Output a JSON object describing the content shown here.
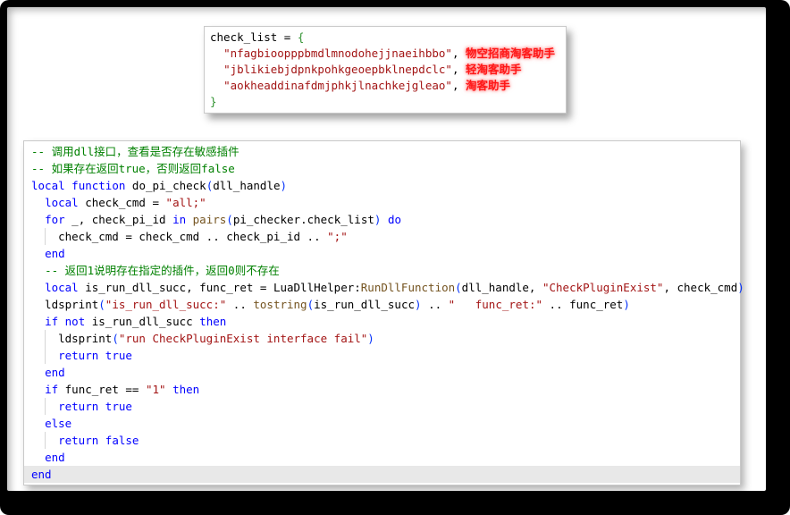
{
  "colors": {
    "plain": "#010101",
    "kw": "#0000ff",
    "str": "#a31515",
    "com": "#008000",
    "fn": "#74531f",
    "brace": "#319331",
    "paren": "#0431fa",
    "ann": "#ff1616",
    "hl": "#e8e8e8"
  },
  "top_panel": {
    "lines": [
      {
        "tokens": [
          {
            "t": "check_list = ",
            "c": "plain"
          },
          {
            "t": "{",
            "c": "brace"
          }
        ]
      },
      {
        "tokens": [
          {
            "t": "  ",
            "c": "plain"
          },
          {
            "t": "\"nfagbioopppbmdlmnodohejjnaeihbbo\"",
            "c": "str"
          },
          {
            "t": ", ",
            "c": "plain"
          },
          {
            "t": "物空招商淘客助手",
            "c": "ann"
          }
        ]
      },
      {
        "tokens": [
          {
            "t": "  ",
            "c": "plain"
          },
          {
            "t": "\"jblikiebjdpnkpohkgeoepbklnepdclc\"",
            "c": "str"
          },
          {
            "t": ", ",
            "c": "plain"
          },
          {
            "t": "轻淘客助手",
            "c": "ann"
          }
        ]
      },
      {
        "tokens": [
          {
            "t": "  ",
            "c": "plain"
          },
          {
            "t": "\"aokheaddinafdmjphkjlnachkejgleao\"",
            "c": "str"
          },
          {
            "t": ", ",
            "c": "plain"
          },
          {
            "t": "淘客助手",
            "c": "ann"
          }
        ]
      },
      {
        "tokens": [
          {
            "t": "}",
            "c": "brace"
          }
        ]
      }
    ]
  },
  "code_panel": {
    "lines": [
      {
        "tokens": [
          {
            "t": "-- 调用dll接口，查看是否存在敏感插件",
            "c": "com"
          }
        ]
      },
      {
        "tokens": [
          {
            "t": "-- 如果存在返回true，否则返回false",
            "c": "com"
          }
        ]
      },
      {
        "tokens": [
          {
            "t": "local",
            "c": "kw"
          },
          {
            "t": " ",
            "c": "plain"
          },
          {
            "t": "function",
            "c": "kw"
          },
          {
            "t": " do_pi_check",
            "c": "plain"
          },
          {
            "t": "(",
            "c": "paren"
          },
          {
            "t": "dll_handle",
            "c": "plain"
          },
          {
            "t": ")",
            "c": "paren"
          }
        ]
      },
      {
        "tokens": [
          {
            "t": "  ",
            "c": "plain"
          },
          {
            "t": "local",
            "c": "kw"
          },
          {
            "t": " check_cmd = ",
            "c": "plain"
          },
          {
            "t": "\"all;\"",
            "c": "str"
          }
        ]
      },
      {
        "tokens": [
          {
            "t": "  ",
            "c": "plain"
          },
          {
            "t": "for",
            "c": "kw"
          },
          {
            "t": " _, check_pi_id ",
            "c": "plain"
          },
          {
            "t": "in",
            "c": "kw"
          },
          {
            "t": " ",
            "c": "plain"
          },
          {
            "t": "pairs",
            "c": "fn"
          },
          {
            "t": "(",
            "c": "paren"
          },
          {
            "t": "pi_checker.check_list",
            "c": "plain"
          },
          {
            "t": ")",
            "c": "paren"
          },
          {
            "t": " ",
            "c": "plain"
          },
          {
            "t": "do",
            "c": "kw"
          }
        ]
      },
      {
        "g": 1,
        "tokens": [
          {
            "t": "    check_cmd = check_cmd .. check_pi_id .. ",
            "c": "plain"
          },
          {
            "t": "\";\"",
            "c": "str"
          }
        ]
      },
      {
        "tokens": [
          {
            "t": "  ",
            "c": "plain"
          },
          {
            "t": "end",
            "c": "kw"
          }
        ]
      },
      {
        "tokens": [
          {
            "t": "  ",
            "c": "plain"
          },
          {
            "t": "-- 返回1说明存在指定的插件，返回0则不存在",
            "c": "com"
          }
        ]
      },
      {
        "tokens": [
          {
            "t": "  ",
            "c": "plain"
          },
          {
            "t": "local",
            "c": "kw"
          },
          {
            "t": " is_run_dll_succ, func_ret = LuaDllHelper:",
            "c": "plain"
          },
          {
            "t": "RunDllFunction",
            "c": "fn"
          },
          {
            "t": "(",
            "c": "paren"
          },
          {
            "t": "dll_handle, ",
            "c": "plain"
          },
          {
            "t": "\"CheckPluginExist\"",
            "c": "str"
          },
          {
            "t": ", check_cmd",
            "c": "plain"
          },
          {
            "t": ")",
            "c": "paren"
          }
        ]
      },
      {
        "tokens": [
          {
            "t": "  ldsprint",
            "c": "plain"
          },
          {
            "t": "(",
            "c": "paren"
          },
          {
            "t": "\"is_run_dll_succ:\"",
            "c": "str"
          },
          {
            "t": " .. ",
            "c": "plain"
          },
          {
            "t": "tostring",
            "c": "fn"
          },
          {
            "t": "(",
            "c": "paren"
          },
          {
            "t": "is_run_dll_succ",
            "c": "plain"
          },
          {
            "t": ")",
            "c": "paren"
          },
          {
            "t": " .. ",
            "c": "plain"
          },
          {
            "t": "\"   func_ret:\"",
            "c": "str"
          },
          {
            "t": " .. func_ret",
            "c": "plain"
          },
          {
            "t": ")",
            "c": "paren"
          }
        ]
      },
      {
        "tokens": [
          {
            "t": "  ",
            "c": "plain"
          },
          {
            "t": "if",
            "c": "kw"
          },
          {
            "t": " ",
            "c": "plain"
          },
          {
            "t": "not",
            "c": "kw"
          },
          {
            "t": " is_run_dll_succ ",
            "c": "plain"
          },
          {
            "t": "then",
            "c": "kw"
          }
        ]
      },
      {
        "g": 1,
        "tokens": [
          {
            "t": "    ldsprint",
            "c": "plain"
          },
          {
            "t": "(",
            "c": "paren"
          },
          {
            "t": "\"run CheckPluginExist interface fail\"",
            "c": "str"
          },
          {
            "t": ")",
            "c": "paren"
          }
        ]
      },
      {
        "g": 1,
        "tokens": [
          {
            "t": "    ",
            "c": "plain"
          },
          {
            "t": "return",
            "c": "kw"
          },
          {
            "t": " ",
            "c": "plain"
          },
          {
            "t": "true",
            "c": "kw"
          }
        ]
      },
      {
        "tokens": [
          {
            "t": "  ",
            "c": "plain"
          },
          {
            "t": "end",
            "c": "kw"
          }
        ]
      },
      {
        "tokens": [
          {
            "t": "  ",
            "c": "plain"
          },
          {
            "t": "if",
            "c": "kw"
          },
          {
            "t": " func_ret == ",
            "c": "plain"
          },
          {
            "t": "\"1\"",
            "c": "str"
          },
          {
            "t": " ",
            "c": "plain"
          },
          {
            "t": "then",
            "c": "kw"
          }
        ]
      },
      {
        "g": 1,
        "tokens": [
          {
            "t": "    ",
            "c": "plain"
          },
          {
            "t": "return",
            "c": "kw"
          },
          {
            "t": " ",
            "c": "plain"
          },
          {
            "t": "true",
            "c": "kw"
          }
        ]
      },
      {
        "tokens": [
          {
            "t": "  ",
            "c": "plain"
          },
          {
            "t": "else",
            "c": "kw"
          }
        ]
      },
      {
        "g": 1,
        "tokens": [
          {
            "t": "    ",
            "c": "plain"
          },
          {
            "t": "return",
            "c": "kw"
          },
          {
            "t": " ",
            "c": "plain"
          },
          {
            "t": "false",
            "c": "kw"
          }
        ]
      },
      {
        "tokens": [
          {
            "t": "  ",
            "c": "plain"
          },
          {
            "t": "end",
            "c": "kw"
          }
        ]
      },
      {
        "highlight": true,
        "tokens": [
          {
            "t": "end",
            "c": "kw"
          }
        ]
      }
    ]
  }
}
